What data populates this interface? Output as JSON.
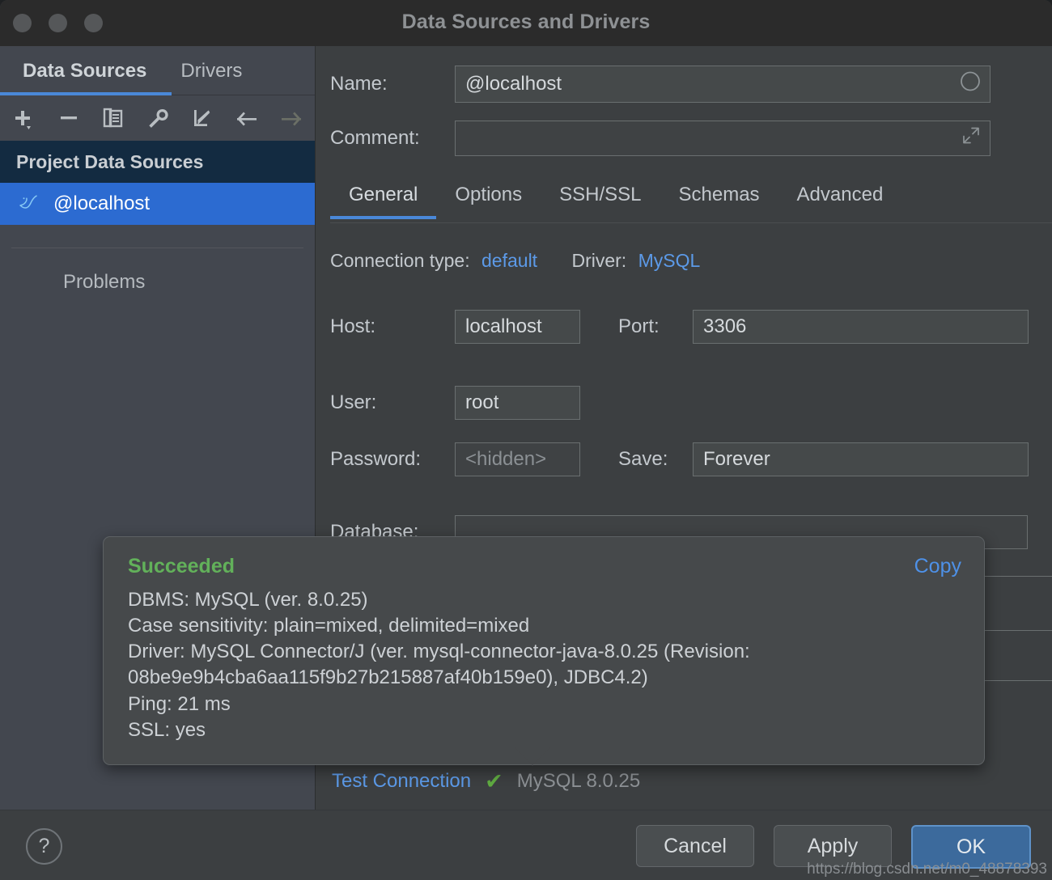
{
  "window": {
    "title": "Data Sources and Drivers",
    "traffic_lights": [
      "close",
      "minimize",
      "zoom"
    ]
  },
  "sidebar": {
    "tabs": [
      {
        "label": "Data Sources",
        "active": true
      },
      {
        "label": "Drivers",
        "active": false
      }
    ],
    "toolbar": [
      {
        "icon": "add-icon",
        "name": "add-data-source-button"
      },
      {
        "icon": "remove-icon",
        "name": "remove-data-source-button"
      },
      {
        "icon": "duplicate-icon",
        "name": "duplicate-data-source-button"
      },
      {
        "icon": "wrench-icon",
        "name": "properties-button"
      },
      {
        "icon": "import-icon",
        "name": "import-data-source-button"
      },
      {
        "icon": "arrow-left-icon",
        "name": "navigate-back-button"
      },
      {
        "icon": "arrow-right-icon",
        "name": "navigate-forward-button"
      }
    ],
    "group_header": "Project Data Sources",
    "items": [
      {
        "label": "@localhost",
        "icon": "mysql-dolphin-icon",
        "selected": true
      }
    ],
    "problems_label": "Problems"
  },
  "main": {
    "name": {
      "label": "Name:",
      "value": "@localhost",
      "icon": "circle-icon"
    },
    "comment": {
      "label": "Comment:",
      "value": "",
      "placeholder": "",
      "icon": "expand-icon"
    },
    "tabs": [
      {
        "label": "General",
        "active": true
      },
      {
        "label": "Options",
        "active": false
      },
      {
        "label": "SSH/SSL",
        "active": false
      },
      {
        "label": "Schemas",
        "active": false
      },
      {
        "label": "Advanced",
        "active": false
      }
    ],
    "connection_type": {
      "label": "Connection type:",
      "value": "default"
    },
    "driver": {
      "label": "Driver:",
      "value": "MySQL"
    },
    "host": {
      "label": "Host:",
      "value": "localhost"
    },
    "port": {
      "label": "Port:",
      "value": "3306"
    },
    "user": {
      "label": "User:",
      "value": "root"
    },
    "password": {
      "label": "Password:",
      "value": "",
      "placeholder": "<hidden>"
    },
    "save": {
      "label": "Save:",
      "value": "Forever"
    },
    "database": {
      "label": "Database:",
      "value": ""
    },
    "footer": {
      "test_connection": "Test Connection",
      "status_icon": "check-icon",
      "db_version": "MySQL 8.0.25"
    }
  },
  "popup": {
    "status": "Succeeded",
    "copy_label": "Copy",
    "lines": [
      "DBMS: MySQL (ver. 8.0.25)",
      "Case sensitivity: plain=mixed, delimited=mixed",
      "Driver: MySQL Connector/J (ver. mysql-connector-java-8.0.25 (Revision: 08be9e9b4cba6aa115f9b27b215887af40b159e0), JDBC4.2)",
      "Ping: 21 ms",
      "SSL: yes"
    ]
  },
  "bottom": {
    "help_label": "?",
    "cancel_label": "Cancel",
    "apply_label": "Apply",
    "ok_label": "OK"
  },
  "watermark": "https://blog.csdn.net/m0_48878393",
  "colors": {
    "accent_blue": "#4a88d8",
    "link_blue": "#5c9ae8",
    "selection_blue": "#2c6bd1",
    "sidebar_header_navy": "#132b41",
    "success_green": "#62b15a",
    "primary_button": "#3c6a9c",
    "panel_bg": "#3c3f41",
    "sidebar_bg": "#43474f",
    "titlebar_bg": "#2b2b2b"
  }
}
